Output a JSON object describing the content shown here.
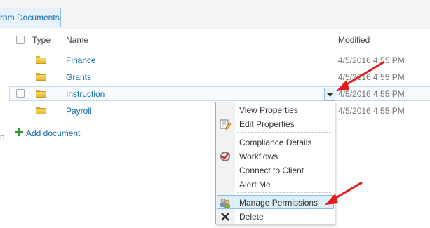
{
  "breadcrumb": {
    "tab_label": "ram Documents"
  },
  "left_sliver": "n",
  "list": {
    "headers": {
      "type": "Type",
      "name": "Name",
      "modified": "Modified"
    },
    "rows": [
      {
        "name": "Finance",
        "modified": "4/5/2016 4:55 PM"
      },
      {
        "name": "Grants",
        "modified": "4/5/2016 4:55 PM"
      },
      {
        "name": "Instruction",
        "modified": "4/5/2016 4:55 PM"
      },
      {
        "name": "Payroll",
        "modified": "4/5/2016 4:55 PM"
      }
    ],
    "add_document": "Add document"
  },
  "context_menu": {
    "items": [
      {
        "label": "View Properties",
        "icon": "none"
      },
      {
        "label": "Edit Properties",
        "icon": "edit-properties-icon"
      },
      {
        "label": "Compliance Details",
        "icon": "none"
      },
      {
        "label": "Workflows",
        "icon": "workflows-icon"
      },
      {
        "label": "Connect to Client",
        "icon": "none"
      },
      {
        "label": "Alert Me",
        "icon": "none"
      },
      {
        "label": "Manage Permissions",
        "icon": "manage-permissions-icon"
      },
      {
        "label": "Delete",
        "icon": "delete-icon"
      }
    ],
    "highlighted_item": "Manage Permissions"
  },
  "colors": {
    "link": "#0f6aa8",
    "annotation_arrow": "#e21b1b",
    "menu_highlight": "#dbeefa"
  }
}
